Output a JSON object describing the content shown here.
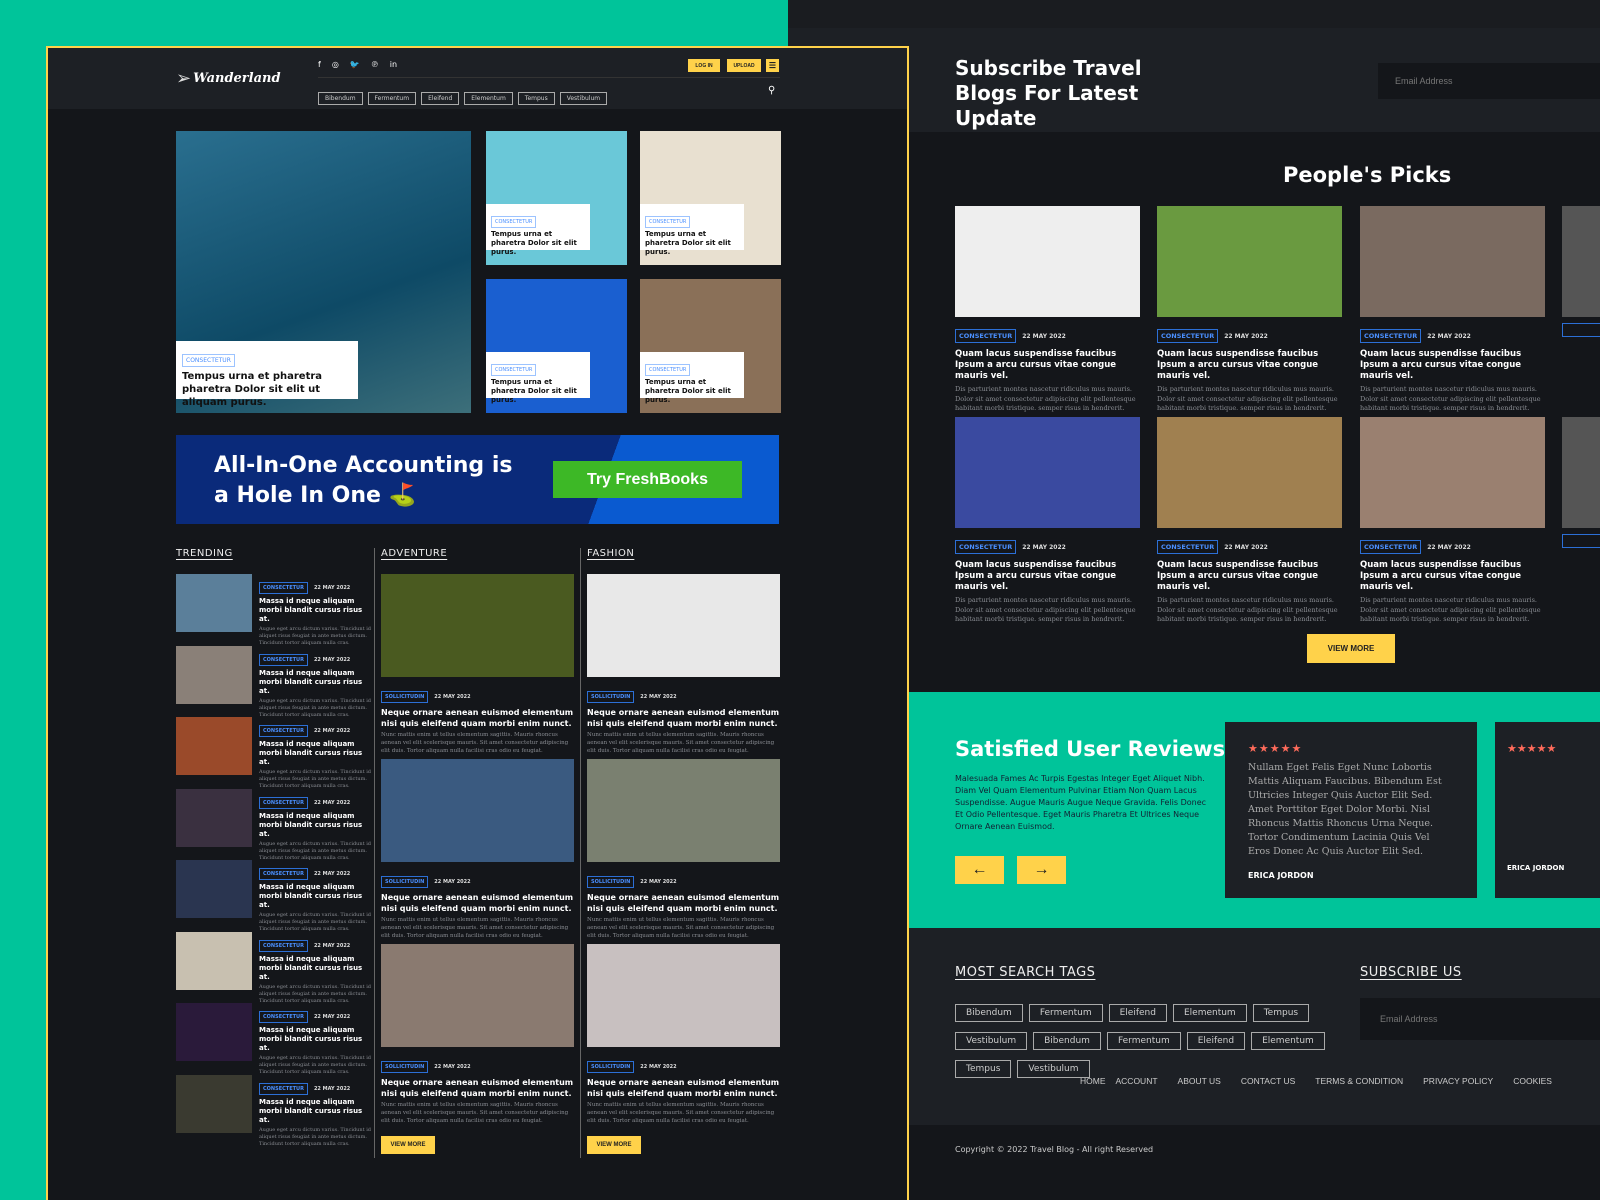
{
  "brand": {
    "name": "Wanderland"
  },
  "header": {
    "social": [
      "f",
      "◎",
      "🐦",
      "℗",
      "in"
    ],
    "login": "LOG IN",
    "upload": "UPLOAD",
    "nav_tags": [
      "Bibendum",
      "Fermentum",
      "Eleifend",
      "Elementum",
      "Tempus",
      "Vestibulum"
    ]
  },
  "hero": {
    "main": {
      "tag": "CONSECTETUR",
      "title": "Tempus urna et pharetra pharetra Dolor sit elit ut aliquam purus."
    },
    "small": [
      {
        "tag": "CONSECTETUR",
        "title": "Tempus urna et pharetra Dolor sit elit purus."
      },
      {
        "tag": "CONSECTETUR",
        "title": "Tempus urna et pharetra Dolor sit elit purus."
      },
      {
        "tag": "CONSECTETUR",
        "title": "Tempus urna et pharetra Dolor sit elit purus."
      },
      {
        "tag": "CONSECTETUR",
        "title": "Tempus urna et pharetra Dolor sit elit purus."
      }
    ]
  },
  "ad": {
    "headline": "All-In-One Accounting is a Hole In One ⛳",
    "cta": "Try FreshBooks"
  },
  "trending": {
    "heading": "TRENDING",
    "item": {
      "tag": "CONSECTETUR",
      "date": "22 MAY 2022",
      "title": "Massa id neque aliquam morbi blandit cursus risus at.",
      "text": "Augue eget arcu dictum varius. Tincidunt id aliquet risus feugiat in ante metus dictum. Tincidunt tortor aliquam nulla cras."
    },
    "count": 8
  },
  "adventure": {
    "heading": "ADVENTURE",
    "view_more": "VIEW MORE"
  },
  "fashion": {
    "heading": "FASHION",
    "view_more": "VIEW MORE"
  },
  "story": {
    "tag": "SOLLICITUDIN",
    "date": "22 MAY 2022",
    "title": "Neque ornare aenean euismod elementum nisi quis eleifend quam morbi enim nunct.",
    "text": "Nunc mattis enim ut tellus elementum sagittis. Mauris rhoncus aenean vel elit scelerisque mauris. Sit amet consectetur adipiscing elit duis. Tortor aliquam nulla facilisi cras odio eu feugiat."
  },
  "subscribe_top": {
    "title": "Subscribe Travel Blogs For Latest Update",
    "placeholder": "Email Address"
  },
  "picks": {
    "heading": "People's Picks",
    "item": {
      "tag": "CONSECTETUR",
      "date": "22 MAY 2022",
      "title": "Quam lacus suspendisse faucibus Ipsum a arcu cursus vitae congue mauris vel.",
      "text": "Dis parturient montes nascetur ridiculus mus mauris. Dolor sit amet consectetur adipiscing elit pellentesque habitant morbi tristique. semper risus in hendrerit."
    },
    "view_more": "VIEW MORE"
  },
  "reviews": {
    "heading": "Satisfied User Reviews",
    "text": "Malesuada Fames Ac Turpis Egestas Integer Eget Aliquet Nibh. Diam Vel Quam Elementum Pulvinar Etiam Non Quam Lacus Suspendisse. Augue Mauris Augue Neque Gravida. Felis Donec Et Odio Pellentesque. Eget Mauris Pharetra Et Ultrices Neque Ornare Aenean Euismod.",
    "prev": "←",
    "next": "→",
    "card": {
      "stars": "★★★★★",
      "rating": 5,
      "text": "Nullam Eget Felis Eget Nunc Lobortis Mattis Aliquam Faucibus. Bibendum Est Ultricies Integer Quis Auctor Elit Sed. Amet Porttitor Eget Dolor Morbi. Nisl Rhoncus Mattis Rhoncus Urna Neque. Tortor Condimentum Lacinia Quis Vel Eros Donec Ac Quis Auctor Elit Sed.",
      "author": "ERICA JORDON"
    }
  },
  "footer": {
    "tags_heading": "MOST SEARCH TAGS",
    "tags": [
      "Bibendum",
      "Fermentum",
      "Eleifend",
      "Elementum",
      "Tempus",
      "Vestibulum",
      "Bibendum",
      "Fermentum",
      "Eleifend",
      "Elementum",
      "Tempus",
      "Vestibulum"
    ],
    "subscribe_heading": "SUBSCRIBE US",
    "placeholder": "Email Address",
    "links": [
      "HOME",
      "ACCOUNT",
      "ABOUT US",
      "CONTACT US",
      "TERMS & CONDITION",
      "PRIVACY POLICY",
      "COOKIES"
    ],
    "copyright": "Copyright © 2022 Travel Blog - All right Reserved"
  },
  "colors": {
    "teal": "#00c49a",
    "yellow": "#ffd24a",
    "dark": "#14161a",
    "tag_blue": "#2c6fd6",
    "star": "#ff6b5b"
  }
}
